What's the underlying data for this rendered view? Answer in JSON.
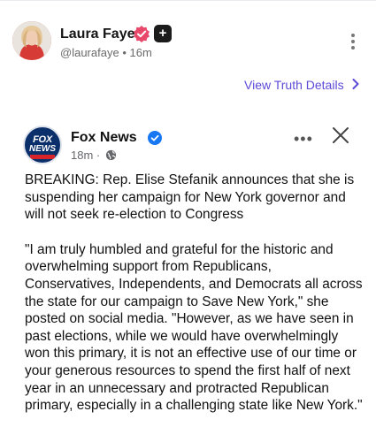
{
  "post": {
    "author_name": "Laura Faye",
    "handle": "@laurafaye",
    "separator": "•",
    "time": "16m",
    "plus_badge": "+",
    "view_details": "View Truth Details",
    "view_details_chevron": "›"
  },
  "embed": {
    "page_name": "Fox News",
    "logo_text_top": "FOX",
    "logo_text_bottom": "NEWS",
    "time": "18m",
    "meta_separator": "·",
    "more_label": "•••",
    "paragraphs": [
      "BREAKING: Rep. Elise Stefanik announces that she is suspending her campaign for New York governor and will not seek re-election to Congress",
      "\"I am truly humbled and grateful for the historic and overwhelming support from Republicans, Conservatives, Independents, and Democrats all across the state for our campaign to Save New York,\" she posted on social media. \"However, as we have seen in past elections, while we would have overwhelmingly won this primary, it is not an effective use of our time or your generous resources to spend the first half of next year in an unnecessary and protracted Republican primary, especially in a challenging state like New York.\""
    ]
  },
  "icons": {
    "verified_pink": "verified-badge-pink",
    "verified_blue": "verified-badge-blue",
    "more": "more-vertical-icon",
    "close": "close-icon",
    "globe": "globe-icon"
  },
  "colors": {
    "accent": "#5b4bd6",
    "verified_pink": "#e8496b",
    "verified_blue": "#1877f2",
    "fox_navy": "#0a2f6b",
    "fox_red": "#d8232a"
  }
}
